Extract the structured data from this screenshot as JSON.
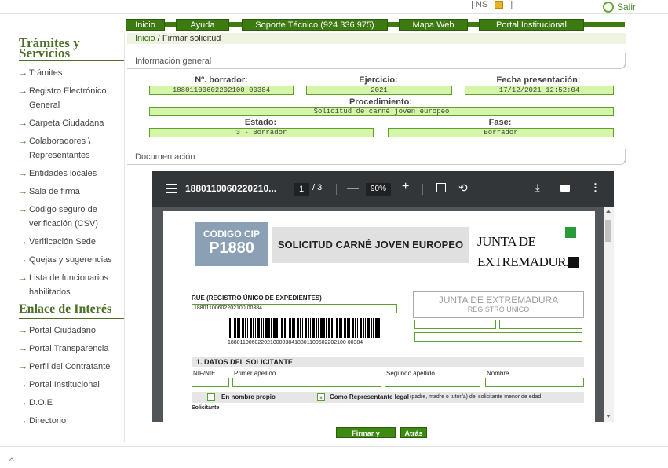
{
  "header": {
    "util_text": "| NS",
    "util_sep": "|",
    "logout": "Salir"
  },
  "nav": [
    {
      "label": "Inicio"
    },
    {
      "label": "Ayuda"
    },
    {
      "label": "Soporte Técnico (924 336 975)"
    },
    {
      "label": "Mapa Web"
    },
    {
      "label": "Portal Institucional"
    }
  ],
  "sidebar": {
    "title1": "Trámites y Servicios",
    "items1": [
      "Trámites",
      "Registro Electrónico General",
      "Carpeta Ciudadana",
      "Colaboradores \\ Representantes",
      "Entidades locales",
      "Sala de firma",
      "Código seguro de verificación (CSV)",
      "Verificación Sede",
      "Quejas y sugerencias",
      "Lista de funcionarios habilitados"
    ],
    "title2": "Enlace de Interés",
    "items2": [
      "Portal Ciudadano",
      "Portal Transparencia",
      "Perfil del Contratante",
      "Portal Institucional",
      "D.O.E",
      "Directorio"
    ]
  },
  "breadcrumb": {
    "home": "Inicio",
    "current": "/ Firmar solicitud"
  },
  "info": {
    "title": "Información general",
    "borrador_label": "Nº. borrador:",
    "borrador": "18801100602202100 00384",
    "ejercicio_label": "Ejercicio:",
    "ejercicio": "2021",
    "fecha_label": "Fecha presentación:",
    "fecha": "17/12/2021 12:52:04",
    "proc_label": "Procedimiento:",
    "proc": "Solicitud de carné joven europeo",
    "estado_label": "Estado:",
    "estado": "3 - Borrador",
    "fase_label": "Fase:",
    "fase": "Borrador"
  },
  "docs": {
    "title": "Documentación"
  },
  "viewer": {
    "filename": "1880110060220210...",
    "page": "1",
    "pages": "/ 3",
    "zoom": "90%"
  },
  "pdf": {
    "cip_l1": "CÓDIGO CIP",
    "cip_l2": "P1880",
    "title": "SOLICITUD CARNÉ JOVEN EUROPEO",
    "junta1": "JUNTA DE",
    "junta2": "EXTREMADURA",
    "rue_label": "RUE (REGISTRO ÚNICO DE EXPEDIENTES)",
    "rue": "18801100602202100 00384",
    "barcode_txt": "188011006022021000038418801100602202100 00384",
    "reg1": "JUNTA DE EXTREMADURA",
    "reg2": "REGISTRO ÚNICO",
    "sec1": "1. DATOS DEL SOLICITANTE",
    "nif": "NIF/NIE",
    "ape1": "Primer apellido",
    "ape2": "Segundo apellido",
    "nombre": "Nombre",
    "propio": "En nombre propio",
    "rep": "Como Representante legal",
    "rep_sub": "(padre, madre o tutor/a) del solicitante menor de edad:",
    "chk_mark": "x",
    "solicitante": "Solicitante"
  },
  "actions": {
    "sign": "Firmar y Registrar",
    "back": "Atrás"
  },
  "footer": {
    "caret": "^"
  }
}
